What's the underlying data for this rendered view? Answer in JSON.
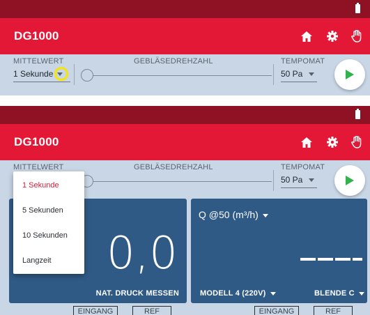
{
  "colors": {
    "status_bar": "#8f1224",
    "app_bar": "#e31836",
    "control_bg": "#c8d6e5",
    "panel": "#2f5a86",
    "play_green": "#2fb34a",
    "highlight": "#f5e60a",
    "selected_item": "#e31836"
  },
  "top_screen": {
    "app_title": "DG1000",
    "icons": [
      "home-icon",
      "gear-icon",
      "hand-icon",
      "battery-icon"
    ],
    "mittelwert_label": "MITTELWERT",
    "mittelwert_value": "1 Sekunde",
    "fan_label": "GEBLÄSEDREHZAHL",
    "tempomat_label": "TEMPOMAT",
    "tempomat_value": "50 Pa"
  },
  "bottom_screen": {
    "app_title": "DG1000",
    "mittelwert_label": "MITTELWERT",
    "fan_label": "GEBLÄSEDREHZAHL",
    "tempomat_label": "TEMPOMAT",
    "tempomat_value": "50 Pa",
    "dropdown": {
      "options": [
        "1 Sekunde",
        "5 Sekunden",
        "10 Sekunden",
        "Langzeit"
      ],
      "selected": "1 Sekunde"
    },
    "left_panel": {
      "value": "0,0",
      "footer": "NAT. DRUCK MESSEN",
      "tab_labels": [
        "EINGANG",
        "REF"
      ]
    },
    "right_panel": {
      "title": "Q @50 (m³/h)",
      "value": "- - - -",
      "model": "MODELL 4 (220V)",
      "blende": "BLENDE C",
      "tab_labels": [
        "EINGANG",
        "REF"
      ]
    }
  }
}
